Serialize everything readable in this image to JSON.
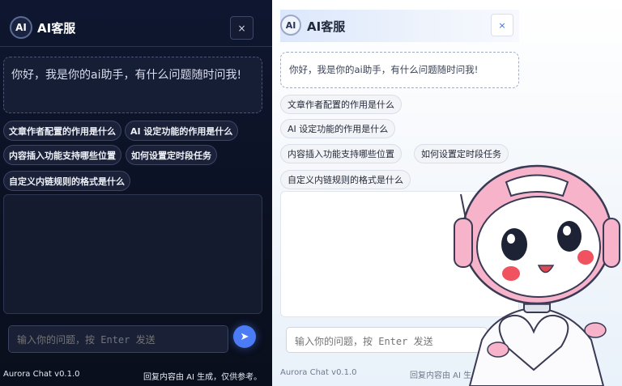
{
  "dark": {
    "logo": "AI",
    "title": "AI客服",
    "close": "×",
    "greeting": "你好，我是你的ai助手，有什么问题随时问我!",
    "suggestions": [
      "文章作者配置的作用是什么",
      "AI 设定功能的作用是什么",
      "内容插入功能支持哪些位置",
      "如何设置定时段任务",
      "自定义内链规则的格式是什么"
    ],
    "input_placeholder": "输入你的问题，按 Enter 发送",
    "send_icon": "➤",
    "version": "Aurora Chat v0.1.0",
    "note": "回复内容由 AI 生成，仅供参考。"
  },
  "light": {
    "logo": "AI",
    "title": "AI客服",
    "close": "×",
    "greeting": "你好，我是你的ai助手，有什么问题随时问我!",
    "suggestions": [
      "文章作者配置的作用是什么",
      "AI 设定功能的作用是什么",
      "内容插入功能支持哪些位置",
      "如何设置定时段任务",
      "自定义内链规则的格式是什么"
    ],
    "input_placeholder": "输入你的问题，按 Enter 发送",
    "send_icon": "➤",
    "version": "Aurora Chat v0.1.0",
    "note": "回复内容由 AI 生成，仅供参考"
  },
  "colors": {
    "dark_bg": "#0b1122",
    "accent_blue": "#4b7cf6",
    "light_header": "#dbe7fb",
    "mascot_pink": "#f3a6c0"
  }
}
